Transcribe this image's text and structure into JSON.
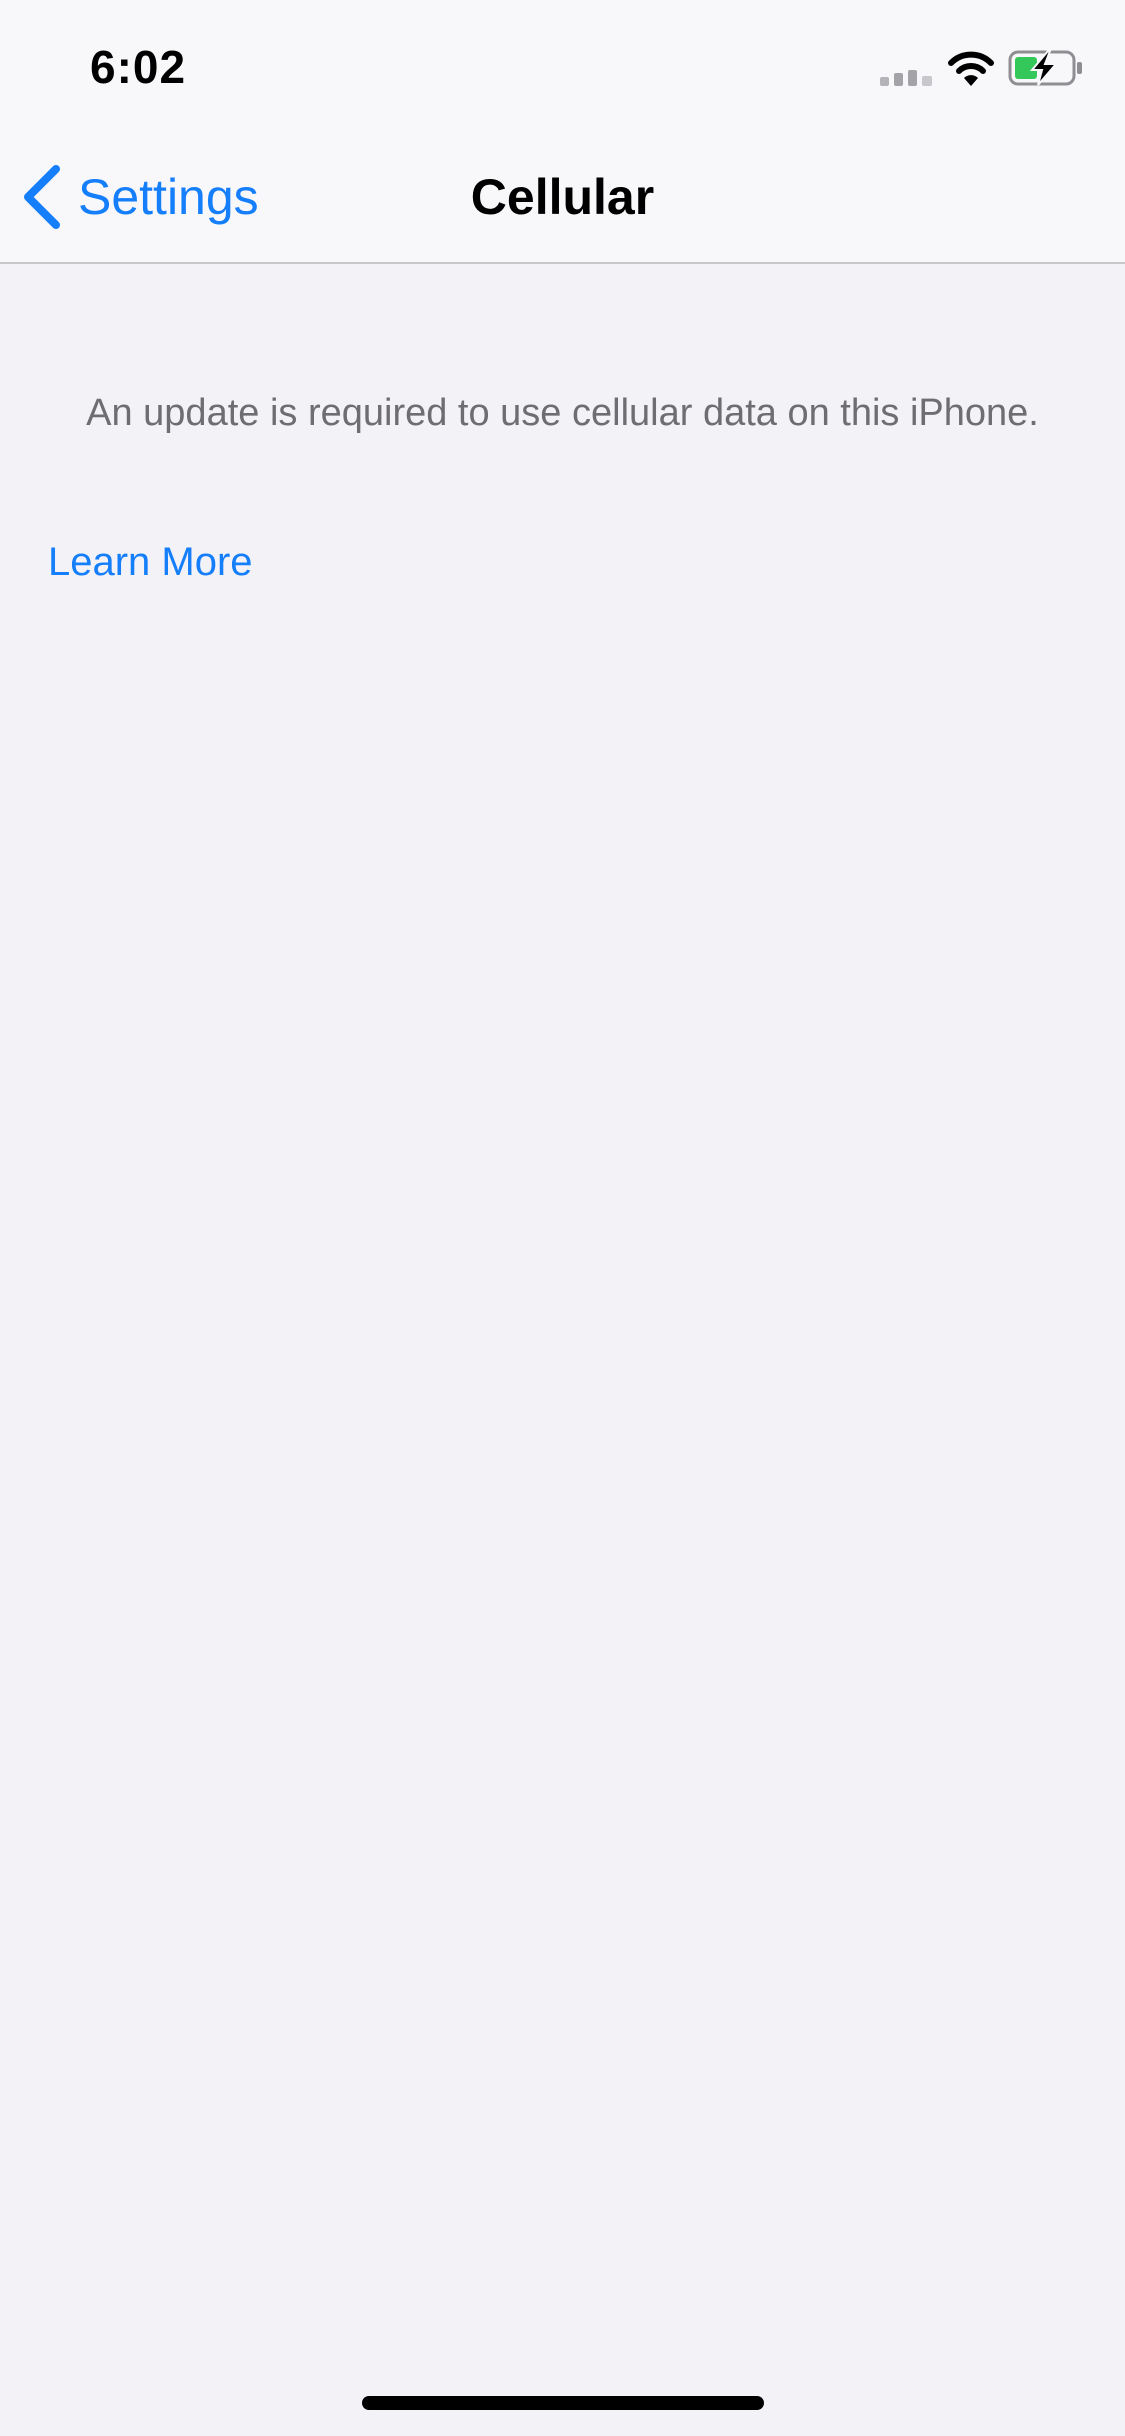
{
  "status_bar": {
    "time": "6:02",
    "icons": [
      "signal-bars-icon",
      "wifi-icon",
      "battery-charging-icon"
    ],
    "battery_color": "#34c759"
  },
  "nav": {
    "back_label": "Settings",
    "title": "Cellular"
  },
  "content": {
    "message": "An update is required to use cellular data on this iPhone.",
    "link_label": "Learn More"
  },
  "colors": {
    "accent": "#147efb",
    "background": "#f2f2f7",
    "secondary_text": "#6d6d72"
  }
}
